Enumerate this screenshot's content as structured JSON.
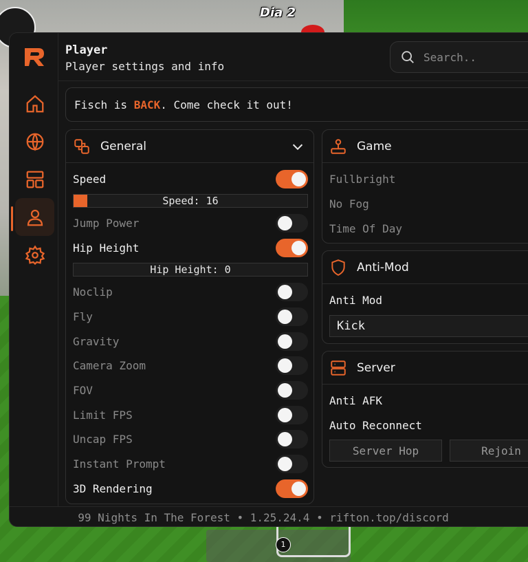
{
  "scene": {
    "day_label": "Dia 2",
    "hotbar_slot_number": "1"
  },
  "header": {
    "title": "Player",
    "subtitle": "Player settings and info",
    "search_placeholder": "Search.."
  },
  "banner": {
    "prefix": "Fisch is ",
    "highlight": "BACK",
    "suffix": ". Come check it out!"
  },
  "nav": [
    {
      "icon": "home-icon",
      "active": false
    },
    {
      "icon": "globe-icon",
      "active": false
    },
    {
      "icon": "layout-icon",
      "active": false
    },
    {
      "icon": "user-icon",
      "active": true
    },
    {
      "icon": "gear-icon",
      "active": false
    }
  ],
  "general": {
    "title": "General",
    "speed": {
      "label": "Speed",
      "on": true
    },
    "speed_slider": {
      "text": "Speed: 16",
      "fill_fraction": 0.06
    },
    "jump_power": {
      "label": "Jump Power",
      "on": false
    },
    "hip_height": {
      "label": "Hip Height",
      "on": true
    },
    "hip_slider": {
      "text": "Hip Height: 0",
      "fill_fraction": 0
    },
    "noclip": {
      "label": "Noclip",
      "on": false
    },
    "fly": {
      "label": "Fly",
      "on": false
    },
    "gravity": {
      "label": "Gravity",
      "on": false
    },
    "camera_zoom": {
      "label": "Camera Zoom",
      "on": false
    },
    "fov": {
      "label": "FOV",
      "on": false
    },
    "limit_fps": {
      "label": "Limit FPS",
      "on": false
    },
    "uncap_fps": {
      "label": "Uncap FPS",
      "on": false
    },
    "instant_prompt": {
      "label": "Instant Prompt",
      "on": false
    },
    "rendering_3d": {
      "label": "3D Rendering",
      "on": true
    }
  },
  "game": {
    "title": "Game",
    "items": [
      "Fullbright",
      "No Fog",
      "Time Of Day"
    ]
  },
  "antimod": {
    "title": "Anti-Mod",
    "label": "Anti Mod",
    "selected": "Kick"
  },
  "server": {
    "title": "Server",
    "anti_afk": "Anti AFK",
    "auto_reconnect": "Auto Reconnect",
    "server_hop": "Server Hop",
    "rejoin": "Rejoin"
  },
  "footer": {
    "text": "99 Nights In The Forest • 1.25.24.4 • rifton.top/discord"
  },
  "colors": {
    "accent": "#e8652b",
    "background": "#161616"
  }
}
